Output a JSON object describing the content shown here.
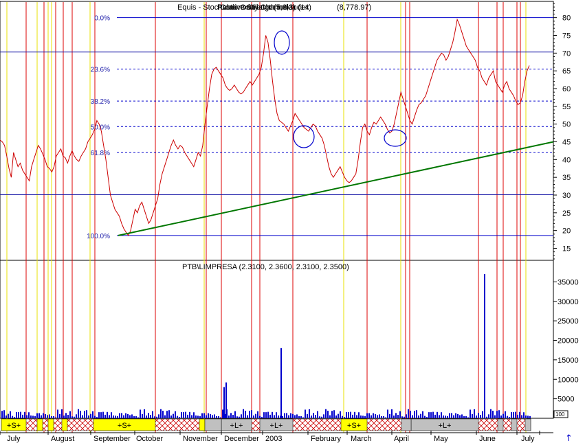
{
  "chart_data": [
    {
      "type": "line",
      "title_overlay": [
        "Equis - Stochastic Oscillator (5,3,3)",
        "Relative Strength Index (14)",
        "Commodity Channel Index",
        "(8,778.97)"
      ],
      "ylim": [
        12,
        84
      ],
      "yticks": [
        15,
        20,
        25,
        30,
        35,
        40,
        45,
        50,
        55,
        60,
        65,
        70,
        75,
        80
      ],
      "fib_levels": [
        {
          "label": "0.0%",
          "value": 80
        },
        {
          "label": "23.6%",
          "value": 65.5
        },
        {
          "label": "38.2%",
          "value": 56.5
        },
        {
          "label": "50.0%",
          "value": 49.3
        },
        {
          "label": "61.8%",
          "value": 42
        },
        {
          "label": "100.0%",
          "value": 18.6
        }
      ],
      "hlines": [
        70.3,
        30.1
      ],
      "trendline": {
        "start": [
          "2002-09-09",
          18.6
        ],
        "end": [
          "2003-07-15",
          45
        ]
      },
      "series": [
        {
          "color": "#cc0000",
          "x_range": [
            "2002-06-20",
            "2003-07-08"
          ],
          "values": [
            45.5,
            45,
            44,
            41,
            37.5,
            35,
            42,
            40,
            38,
            39,
            37,
            36,
            35,
            34,
            38,
            40,
            42,
            44,
            43,
            41.5,
            40,
            38,
            37.5,
            36.5,
            38,
            41,
            42,
            43,
            41,
            40.5,
            39,
            41,
            42.5,
            41,
            40,
            39.5,
            41,
            42,
            43,
            45,
            46,
            47,
            48.5,
            51,
            50,
            48,
            44,
            40,
            35,
            30,
            28,
            26,
            25,
            24,
            22,
            20.5,
            19.5,
            18.6,
            20,
            23,
            26,
            25,
            27,
            28,
            26,
            24,
            22,
            23,
            25,
            27,
            29,
            33,
            36,
            38,
            40,
            42,
            44,
            45.5,
            44,
            43,
            44,
            43.5,
            42,
            41,
            40,
            39,
            38,
            40,
            42,
            41,
            44,
            50,
            55,
            60,
            64,
            65.5,
            66,
            65,
            64,
            63,
            61,
            60,
            59.5,
            60,
            61,
            60,
            59,
            58.5,
            59,
            60,
            61,
            62,
            61,
            62,
            63,
            64,
            66,
            70,
            75,
            73,
            68,
            62,
            57,
            53,
            51,
            50.5,
            50,
            49,
            48,
            49.5,
            51,
            53,
            52,
            51,
            50,
            49,
            48.5,
            48,
            49,
            50,
            49.5,
            48,
            47,
            46,
            44,
            41,
            38,
            36,
            35,
            36,
            37,
            38,
            36.5,
            35,
            34,
            33.5,
            34,
            35,
            36,
            40,
            45,
            49,
            50,
            48,
            47,
            49,
            50.5,
            50,
            51,
            52,
            51,
            50,
            48.5,
            47.5,
            48,
            50,
            53,
            56,
            59,
            57,
            55,
            53,
            51,
            50,
            52,
            54,
            55.5,
            56,
            57,
            58,
            60,
            62,
            64,
            66,
            68,
            69,
            70,
            69.5,
            68,
            69,
            71,
            73,
            76,
            79.5,
            78,
            76,
            74,
            72,
            71,
            70,
            69,
            68,
            66,
            65,
            63,
            62,
            61,
            63,
            64,
            65,
            62,
            61,
            60,
            59,
            61,
            62,
            60,
            59,
            58,
            56.5,
            55.5,
            56,
            58,
            62,
            65,
            66.5
          ]
        }
      ],
      "annotations": [
        "ellipse-peak",
        "ellipse-trough",
        "ellipse-april"
      ]
    },
    {
      "type": "bar",
      "title": "PTB\\LIMPRESA (2.3100, 2.3600, 2.3100, 2.3500)",
      "ylim": [
        0,
        40000
      ],
      "yticks": [
        5000,
        10000,
        15000,
        20000,
        25000,
        30000,
        35000
      ],
      "spikes": [
        {
          "month_index": 5,
          "value": 8000
        },
        {
          "month_index": 6,
          "value": 9200
        },
        {
          "month_index": 6,
          "value": 18000
        },
        {
          "month_index": 11,
          "value": 37000
        }
      ],
      "baseline_values": [
        600,
        1200,
        900,
        1500,
        700,
        1800,
        1100,
        2200,
        800,
        1300,
        2500,
        1000,
        1600,
        700,
        1900,
        1200,
        900,
        1400,
        3000,
        1100,
        800,
        1700,
        1300,
        2100,
        900,
        1500,
        1000,
        2600,
        1200,
        800,
        1400,
        1800,
        1100,
        700,
        1300,
        2300,
        1000,
        1600,
        900,
        1200
      ]
    }
  ],
  "months": [
    "July",
    "August",
    "September",
    "October",
    "November",
    "December",
    "2003",
    "February",
    "March",
    "April",
    "May",
    "June",
    "July"
  ],
  "signal_bands": [
    {
      "label": "+S+",
      "color": "#ffff00"
    },
    {
      "label": "+S+",
      "color": "#ffff00"
    },
    {
      "label": "+L+",
      "color": "#c0c0c0"
    },
    {
      "label": "+L+",
      "color": "#c0c0c0"
    },
    {
      "label": "+S+",
      "color": "#ffff00"
    },
    {
      "label": "+L+",
      "color": "#c0c0c0"
    }
  ],
  "legend_box": "100",
  "scroll_arrow": "↑",
  "colors": {
    "price": "#cc0000",
    "trend": "#007700",
    "fib": "#0000cc",
    "volume": "#0000cc",
    "red_vline": "#dd0000",
    "yellow_vline": "#e8e000"
  }
}
